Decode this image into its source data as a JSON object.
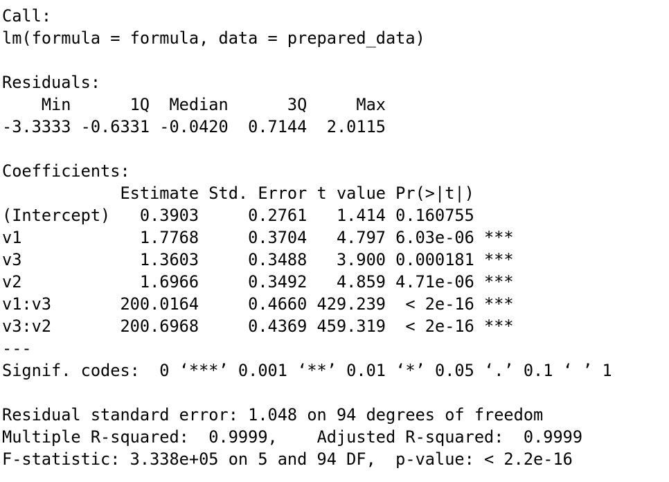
{
  "output": {
    "lines": [
      "Call:",
      "lm(formula = formula, data = prepared_data)",
      "",
      "Residuals:",
      "    Min      1Q  Median      3Q     Max ",
      "-3.3333 -0.6331 -0.0420  0.7144  2.0115 ",
      "",
      "Coefficients:",
      "            Estimate Std. Error t value Pr(>|t|)    ",
      "(Intercept)   0.3903     0.2761   1.414 0.160755    ",
      "v1            1.7768     0.3704   4.797 6.03e-06 ***",
      "v3            1.3603     0.3488   3.900 0.000181 ***",
      "v2            1.6966     0.3492   4.859 4.71e-06 ***",
      "v1:v3       200.0164     0.4660 429.239  < 2e-16 ***",
      "v3:v2       200.6968     0.4369 459.319  < 2e-16 ***",
      "---",
      "Signif. codes:  0 ‘***’ 0.001 ‘**’ 0.01 ‘*’ 0.05 ‘.’ 0.1 ‘ ’ 1",
      "",
      "Residual standard error: 1.048 on 94 degrees of freedom",
      "Multiple R-squared:  0.9999,\tAdjusted R-squared:  0.9999 ",
      "F-statistic: 3.338e+05 on 5 and 94 DF,  p-value: < 2.2e-16"
    ]
  }
}
